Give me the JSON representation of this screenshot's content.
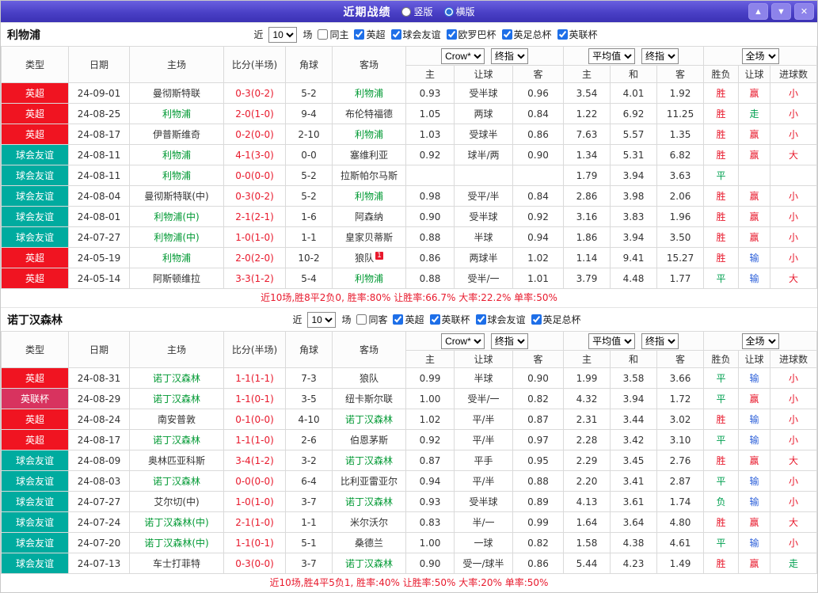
{
  "titlebar": {
    "title": "近期战绩",
    "vertical_label": "竖版",
    "horizontal_label": "横版",
    "selected_layout": "横版",
    "up_icon": "▲",
    "down_icon": "▼",
    "close_icon": "✕"
  },
  "colors": {
    "titlebar_top": "#6a60e0",
    "titlebar_bottom": "#3b31b4",
    "accent_blue": "#1e6fe8",
    "score": "#e8192c",
    "team_highlight": "#009933",
    "summary_text": "#e8192c",
    "league": {
      "英超": "#f01421",
      "英联杯": "#d8335f",
      "球会友谊": "#00ab9f"
    },
    "result": {
      "胜": "#e8192c",
      "平": "#00a050",
      "负": "#00a050",
      "赢": "#e8192c",
      "输": "#2b5fd9",
      "走": "#00a050",
      "大": "#e8192c",
      "小": "#e8192c"
    }
  },
  "sections": [
    {
      "team": "利物浦",
      "filter": {
        "near_label": "近",
        "count": "10",
        "games_label": "场",
        "same_label": "同主",
        "same_checked": false,
        "leagues": [
          {
            "label": "英超",
            "checked": true
          },
          {
            "label": "球会友谊",
            "checked": true
          },
          {
            "label": "欧罗巴杯",
            "checked": true
          },
          {
            "label": "英足总杯",
            "checked": true
          },
          {
            "label": "英联杯",
            "checked": true
          }
        ]
      },
      "header": {
        "type": "类型",
        "date": "日期",
        "home": "主场",
        "score": "比分(半场)",
        "corner": "角球",
        "away": "客场",
        "odds_source": "Crow*",
        "odds_time": "终指",
        "avg_source": "平均值",
        "avg_time": "终指",
        "scope": "全场",
        "sub": [
          "主",
          "让球",
          "客",
          "主",
          "和",
          "客",
          "胜负",
          "让球",
          "进球数"
        ]
      },
      "rows": [
        {
          "type": "英超",
          "date": "24-09-01",
          "home": "曼彻斯特联",
          "home_hl": false,
          "score": "0-3(0-2)",
          "corner": "5-2",
          "away": "利物浦",
          "away_hl": true,
          "odds_home": "0.93",
          "handicap": "受半球",
          "odds_away": "0.96",
          "avg_home": "3.54",
          "avg_draw": "4.01",
          "avg_away": "1.92",
          "result": "胜",
          "handicap_result": "赢",
          "goals_result": "小"
        },
        {
          "type": "英超",
          "date": "24-08-25",
          "home": "利物浦",
          "home_hl": true,
          "score": "2-0(1-0)",
          "corner": "9-4",
          "away": "布伦特福德",
          "away_hl": false,
          "odds_home": "1.05",
          "handicap": "两球",
          "odds_away": "0.84",
          "avg_home": "1.22",
          "avg_draw": "6.92",
          "avg_away": "11.25",
          "result": "胜",
          "handicap_result": "走",
          "goals_result": "小"
        },
        {
          "type": "英超",
          "date": "24-08-17",
          "home": "伊普斯维奇",
          "home_hl": false,
          "score": "0-2(0-0)",
          "corner": "2-10",
          "away": "利物浦",
          "away_hl": true,
          "odds_home": "1.03",
          "handicap": "受球半",
          "odds_away": "0.86",
          "avg_home": "7.63",
          "avg_draw": "5.57",
          "avg_away": "1.35",
          "result": "胜",
          "handicap_result": "赢",
          "goals_result": "小"
        },
        {
          "type": "球会友谊",
          "date": "24-08-11",
          "home": "利物浦",
          "home_hl": true,
          "score": "4-1(3-0)",
          "corner": "0-0",
          "away": "塞维利亚",
          "away_hl": false,
          "odds_home": "0.92",
          "handicap": "球半/两",
          "odds_away": "0.90",
          "avg_home": "1.34",
          "avg_draw": "5.31",
          "avg_away": "6.82",
          "result": "胜",
          "handicap_result": "赢",
          "goals_result": "大"
        },
        {
          "type": "球会友谊",
          "date": "24-08-11",
          "home": "利物浦",
          "home_hl": true,
          "score": "0-0(0-0)",
          "corner": "5-2",
          "away": "拉斯帕尔马斯",
          "away_hl": false,
          "odds_home": "",
          "handicap": "",
          "odds_away": "",
          "avg_home": "1.79",
          "avg_draw": "3.94",
          "avg_away": "3.63",
          "result": "平",
          "handicap_result": "",
          "goals_result": ""
        },
        {
          "type": "球会友谊",
          "date": "24-08-04",
          "home": "曼彻斯特联(中)",
          "home_hl": false,
          "score": "0-3(0-2)",
          "corner": "5-2",
          "away": "利物浦",
          "away_hl": true,
          "odds_home": "0.98",
          "handicap": "受平/半",
          "odds_away": "0.84",
          "avg_home": "2.86",
          "avg_draw": "3.98",
          "avg_away": "2.06",
          "result": "胜",
          "handicap_result": "赢",
          "goals_result": "小"
        },
        {
          "type": "球会友谊",
          "date": "24-08-01",
          "home": "利物浦(中)",
          "home_hl": true,
          "score": "2-1(2-1)",
          "corner": "1-6",
          "away": "阿森纳",
          "away_hl": false,
          "odds_home": "0.90",
          "handicap": "受半球",
          "odds_away": "0.92",
          "avg_home": "3.16",
          "avg_draw": "3.83",
          "avg_away": "1.96",
          "result": "胜",
          "handicap_result": "赢",
          "goals_result": "小"
        },
        {
          "type": "球会友谊",
          "date": "24-07-27",
          "home": "利物浦(中)",
          "home_hl": true,
          "score": "1-0(1-0)",
          "corner": "1-1",
          "away": "皇家贝蒂斯",
          "away_hl": false,
          "odds_home": "0.88",
          "handicap": "半球",
          "odds_away": "0.94",
          "avg_home": "1.86",
          "avg_draw": "3.94",
          "avg_away": "3.50",
          "result": "胜",
          "handicap_result": "赢",
          "goals_result": "小"
        },
        {
          "type": "英超",
          "date": "24-05-19",
          "home": "利物浦",
          "home_hl": true,
          "score": "2-0(2-0)",
          "corner": "10-2",
          "away": "狼队",
          "away_hl": false,
          "away_sup": "1",
          "odds_home": "0.86",
          "handicap": "两球半",
          "odds_away": "1.02",
          "avg_home": "1.14",
          "avg_draw": "9.41",
          "avg_away": "15.27",
          "result": "胜",
          "handicap_result": "输",
          "goals_result": "小"
        },
        {
          "type": "英超",
          "date": "24-05-14",
          "home": "阿斯顿维拉",
          "home_hl": false,
          "score": "3-3(1-2)",
          "corner": "5-4",
          "away": "利物浦",
          "away_hl": true,
          "odds_home": "0.88",
          "handicap": "受半/一",
          "odds_away": "1.01",
          "avg_home": "3.79",
          "avg_draw": "4.48",
          "avg_away": "1.77",
          "result": "平",
          "handicap_result": "输",
          "goals_result": "大"
        }
      ],
      "summary": "近10场,胜8平2负0, 胜率:80% 让胜率:66.7% 大率:22.2% 单率:50%"
    },
    {
      "team": "诺丁汉森林",
      "filter": {
        "near_label": "近",
        "count": "10",
        "games_label": "场",
        "same_label": "同客",
        "same_checked": false,
        "leagues": [
          {
            "label": "英超",
            "checked": true
          },
          {
            "label": "英联杯",
            "checked": true
          },
          {
            "label": "球会友谊",
            "checked": true
          },
          {
            "label": "英足总杯",
            "checked": true
          }
        ]
      },
      "header": {
        "type": "类型",
        "date": "日期",
        "home": "主场",
        "score": "比分(半场)",
        "corner": "角球",
        "away": "客场",
        "odds_source": "Crow*",
        "odds_time": "终指",
        "avg_source": "平均值",
        "avg_time": "终指",
        "scope": "全场",
        "sub": [
          "主",
          "让球",
          "客",
          "主",
          "和",
          "客",
          "胜负",
          "让球",
          "进球数"
        ]
      },
      "rows": [
        {
          "type": "英超",
          "date": "24-08-31",
          "home": "诺丁汉森林",
          "home_hl": true,
          "score": "1-1(1-1)",
          "corner": "7-3",
          "away": "狼队",
          "away_hl": false,
          "odds_home": "0.99",
          "handicap": "半球",
          "odds_away": "0.90",
          "avg_home": "1.99",
          "avg_draw": "3.58",
          "avg_away": "3.66",
          "result": "平",
          "handicap_result": "输",
          "goals_result": "小"
        },
        {
          "type": "英联杯",
          "date": "24-08-29",
          "home": "诺丁汉森林",
          "home_hl": true,
          "score": "1-1(0-1)",
          "corner": "3-5",
          "away": "纽卡斯尔联",
          "away_hl": false,
          "odds_home": "1.00",
          "handicap": "受半/一",
          "odds_away": "0.82",
          "avg_home": "4.32",
          "avg_draw": "3.94",
          "avg_away": "1.72",
          "result": "平",
          "handicap_result": "赢",
          "goals_result": "小"
        },
        {
          "type": "英超",
          "date": "24-08-24",
          "home": "南安普敦",
          "home_hl": false,
          "score": "0-1(0-0)",
          "corner": "4-10",
          "away": "诺丁汉森林",
          "away_hl": true,
          "odds_home": "1.02",
          "handicap": "平/半",
          "odds_away": "0.87",
          "avg_home": "2.31",
          "avg_draw": "3.44",
          "avg_away": "3.02",
          "result": "胜",
          "handicap_result": "输",
          "goals_result": "小"
        },
        {
          "type": "英超",
          "date": "24-08-17",
          "home": "诺丁汉森林",
          "home_hl": true,
          "score": "1-1(1-0)",
          "corner": "2-6",
          "away": "伯恩茅斯",
          "away_hl": false,
          "odds_home": "0.92",
          "handicap": "平/半",
          "odds_away": "0.97",
          "avg_home": "2.28",
          "avg_draw": "3.42",
          "avg_away": "3.10",
          "result": "平",
          "handicap_result": "输",
          "goals_result": "小"
        },
        {
          "type": "球会友谊",
          "date": "24-08-09",
          "home": "奥林匹亚科斯",
          "home_hl": false,
          "score": "3-4(1-2)",
          "corner": "3-2",
          "away": "诺丁汉森林",
          "away_hl": true,
          "odds_home": "0.87",
          "handicap": "平手",
          "odds_away": "0.95",
          "avg_home": "2.29",
          "avg_draw": "3.45",
          "avg_away": "2.76",
          "result": "胜",
          "handicap_result": "赢",
          "goals_result": "大"
        },
        {
          "type": "球会友谊",
          "date": "24-08-03",
          "home": "诺丁汉森林",
          "home_hl": true,
          "score": "0-0(0-0)",
          "corner": "6-4",
          "away": "比利亚雷亚尔",
          "away_hl": false,
          "odds_home": "0.94",
          "handicap": "平/半",
          "odds_away": "0.88",
          "avg_home": "2.20",
          "avg_draw": "3.41",
          "avg_away": "2.87",
          "result": "平",
          "handicap_result": "输",
          "goals_result": "小"
        },
        {
          "type": "球会友谊",
          "date": "24-07-27",
          "home": "艾尔切(中)",
          "home_hl": false,
          "score": "1-0(1-0)",
          "corner": "3-7",
          "away": "诺丁汉森林",
          "away_hl": true,
          "odds_home": "0.93",
          "handicap": "受半球",
          "odds_away": "0.89",
          "avg_home": "4.13",
          "avg_draw": "3.61",
          "avg_away": "1.74",
          "result": "负",
          "handicap_result": "输",
          "goals_result": "小"
        },
        {
          "type": "球会友谊",
          "date": "24-07-24",
          "home": "诺丁汉森林(中)",
          "home_hl": true,
          "score": "2-1(1-0)",
          "corner": "1-1",
          "away": "米尔沃尔",
          "away_hl": false,
          "odds_home": "0.83",
          "handicap": "半/一",
          "odds_away": "0.99",
          "avg_home": "1.64",
          "avg_draw": "3.64",
          "avg_away": "4.80",
          "result": "胜",
          "handicap_result": "赢",
          "goals_result": "大"
        },
        {
          "type": "球会友谊",
          "date": "24-07-20",
          "home": "诺丁汉森林(中)",
          "home_hl": true,
          "score": "1-1(0-1)",
          "corner": "5-1",
          "away": "桑德兰",
          "away_hl": false,
          "odds_home": "1.00",
          "handicap": "一球",
          "odds_away": "0.82",
          "avg_home": "1.58",
          "avg_draw": "4.38",
          "avg_away": "4.61",
          "result": "平",
          "handicap_result": "输",
          "goals_result": "小"
        },
        {
          "type": "球会友谊",
          "date": "24-07-13",
          "home": "车士打菲特",
          "home_hl": false,
          "score": "0-3(0-0)",
          "corner": "3-7",
          "away": "诺丁汉森林",
          "away_hl": true,
          "odds_home": "0.90",
          "handicap": "受一/球半",
          "odds_away": "0.86",
          "avg_home": "5.44",
          "avg_draw": "4.23",
          "avg_away": "1.49",
          "result": "胜",
          "handicap_result": "赢",
          "goals_result": "走"
        }
      ],
      "summary": "近10场,胜4平5负1, 胜率:40% 让胜率:50% 大率:20% 单率:50%"
    }
  ]
}
